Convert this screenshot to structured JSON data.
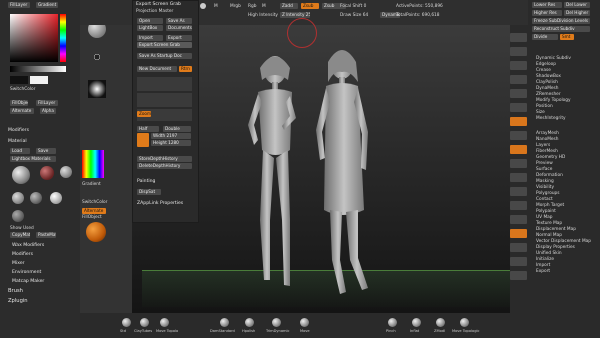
{
  "topbar": {
    "menu_items": [
      "Projection Master",
      "Open",
      "Save As",
      "LightBox",
      "Documents",
      "Import",
      "Export"
    ],
    "scale": {
      "label": "Scale",
      "value": "61"
    },
    "zadd_label": "Zadd",
    "zsub_label": "Zsub",
    "z_intensity": "Z Intensity 25",
    "draw_size": "Draw Size 64",
    "focal_shift": "Focal Shift 0",
    "rgb_label": "Rgb",
    "mrgb_label": "Mrgb",
    "m_label": "M",
    "active_points": "ActivePoints: 550,896",
    "total_points": "TotalPoints: 690,618",
    "dynamic": "Dynamic",
    "high_intensity": "High Intensity"
  },
  "popup": {
    "title": "Export Screen Grab",
    "items": [
      "Open",
      "Save As",
      "LightBox",
      "Documents",
      "Import",
      "Export",
      "Export Screen Grab",
      "Save As Startup Doc",
      "New Document",
      "Rtrn"
    ],
    "zoom_label": "Zoom",
    "half_label": "Half",
    "double_label": "Double",
    "width": "Width 2197",
    "height": "Height 1280",
    "store_depth": "StoreDepthHistory",
    "delete_depth": "DeleteDepthHistory",
    "painting": "Painting",
    "display": "DispSat",
    "zapplink": "ZAppLink Properties"
  },
  "left_tray": {
    "gradient": "Gradient",
    "switch_color": "SwitchColor",
    "alternate": "Alternate",
    "fill_object": "FillObject",
    "modifiers": "Modifiers",
    "material": "Material",
    "load": "Load",
    "save": "Save",
    "lightbox_materials": "Lightbox Materials",
    "show_used": "Show Used",
    "copy_mat": "CopyMat",
    "paste_mat": "PasteMat",
    "wax_modifiers": "Wax Modifiers",
    "modifiers2": "Modifiers",
    "mixer": "Mixer",
    "environment": "Environment",
    "matcap_maker": "Matcap Maker",
    "brush": "Brush",
    "zplugin": "Zplugin",
    "alpha_label": "Alpha",
    "fill_layer": "FillLayer",
    "fill_layer2": "FillLayer"
  },
  "right_tray": {
    "items": [
      "Lower Res",
      "Del Lower",
      "Higher Res",
      "Del Higher",
      "Freeze SubDivision Levels",
      "Reconstruct Subdiv",
      "Smt",
      "Divide",
      "Dynamic Subdiv",
      "Edgeloop",
      "Crease",
      "ShadowBox",
      "ClayPolish",
      "DynaMesh",
      "ZRemesher",
      "Modify Topology",
      "Position",
      "Size",
      "MeshIntegrity",
      "ArrayMesh",
      "NanoMesh",
      "Layers",
      "FiberMesh",
      "Geometry HD",
      "Preview",
      "Surface",
      "Deformation",
      "Masking",
      "Visibility",
      "Polygroups",
      "Contact",
      "Morph Target",
      "Polypaint",
      "UV Map",
      "Texture Map",
      "Displacement Map",
      "Normal Map",
      "Vector Displacement Map",
      "Display Properties",
      "Unified Skin",
      "Initialize",
      "Import",
      "Export"
    ],
    "smt_value": "Smt"
  },
  "bottom_shelf": {
    "brushes": [
      "Std",
      "ClayTubes",
      "Move Topolo",
      "DamStandard",
      "Hpolish",
      "TrimDynamic",
      "Move",
      "Pinch",
      "Inflat",
      "ZModl",
      "Move Topologic"
    ]
  },
  "colors": {
    "accent": "#e07b1a",
    "background": "#3a3a3a"
  }
}
